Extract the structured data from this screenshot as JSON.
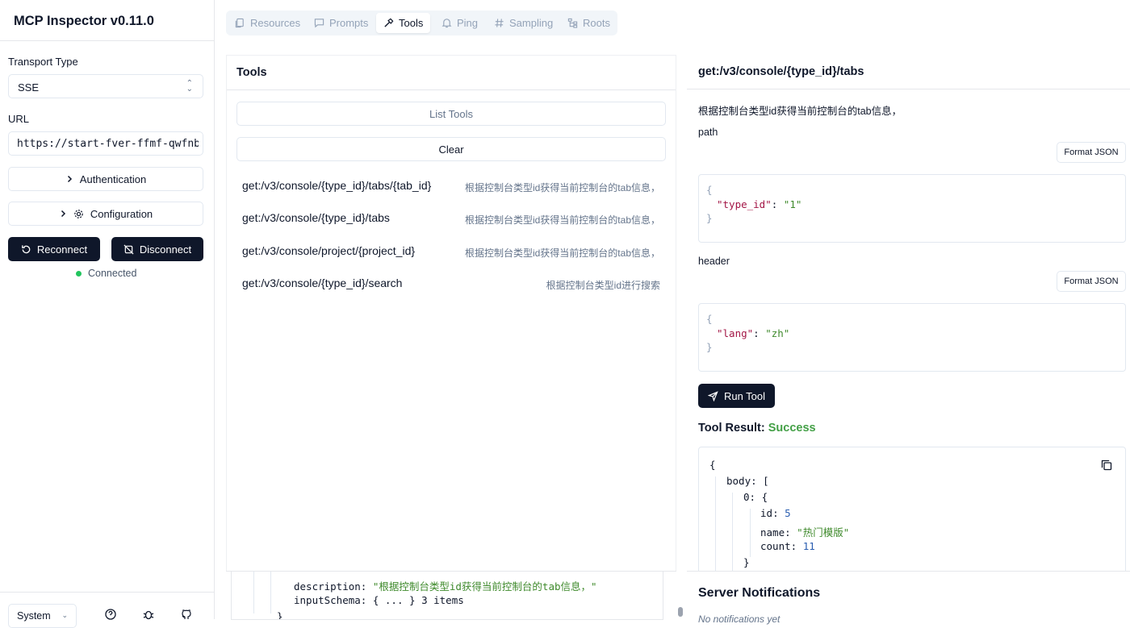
{
  "app": {
    "title": "MCP Inspector v0.11.0"
  },
  "sidebar": {
    "transport_label": "Transport Type",
    "transport_value": "SSE",
    "url_label": "URL",
    "url_value": "https://start-fver-ffmf-qwfnbia",
    "authentication": "Authentication",
    "configuration": "Configuration",
    "reconnect": "Reconnect",
    "disconnect": "Disconnect",
    "status": "Connected",
    "theme": "System"
  },
  "tabs": [
    {
      "label": "Resources",
      "icon": "files-icon"
    },
    {
      "label": "Prompts",
      "icon": "message-icon"
    },
    {
      "label": "Tools",
      "icon": "hammer-icon"
    },
    {
      "label": "Ping",
      "icon": "bell-icon"
    },
    {
      "label": "Sampling",
      "icon": "hash-icon"
    },
    {
      "label": "Roots",
      "icon": "tree-icon"
    }
  ],
  "tools_panel": {
    "title": "Tools",
    "list_tools": "List Tools",
    "clear": "Clear",
    "tools": [
      {
        "name": "get:/v3/console/{type_id}/tabs/{tab_id}",
        "desc": "根据控制台类型id获得当前控制台的tab信息，"
      },
      {
        "name": "get:/v3/console/{type_id}/tabs",
        "desc": "根据控制台类型id获得当前控制台的tab信息，"
      },
      {
        "name": "get:/v3/console/project/{project_id}",
        "desc": "根据控制台类型id获得当前控制台的tab信息，"
      },
      {
        "name": "get:/v3/console/{type_id}/search",
        "desc": "根据控制台类型id进行搜索"
      }
    ]
  },
  "detail": {
    "title": "get:/v3/console/{type_id}/tabs",
    "description": "根据控制台类型id获得当前控制台的tab信息，",
    "path_label": "path",
    "format_json": "Format JSON",
    "path_key": "\"type_id\"",
    "path_val": "\"1\"",
    "header_label": "header",
    "header_key": "\"lang\"",
    "header_val": "\"zh\"",
    "run_tool": "Run Tool",
    "result_label": "Tool Result:",
    "result_status": "Success",
    "result": {
      "body_key": "body",
      "index_key": "0",
      "id_key": "id",
      "id_val": "5",
      "name_key": "name",
      "name_val": "\"热门模版\"",
      "count_key": "count",
      "count_val": "11"
    }
  },
  "history": {
    "desc_key": "description",
    "desc_val": "\"根据控制台类型id获得当前控制台的tab信息，\"",
    "schema_key": "inputSchema",
    "schema_val": "{ ... }",
    "schema_count": "3 items"
  },
  "notifications": {
    "title": "Server Notifications",
    "empty": "No notifications yet"
  }
}
